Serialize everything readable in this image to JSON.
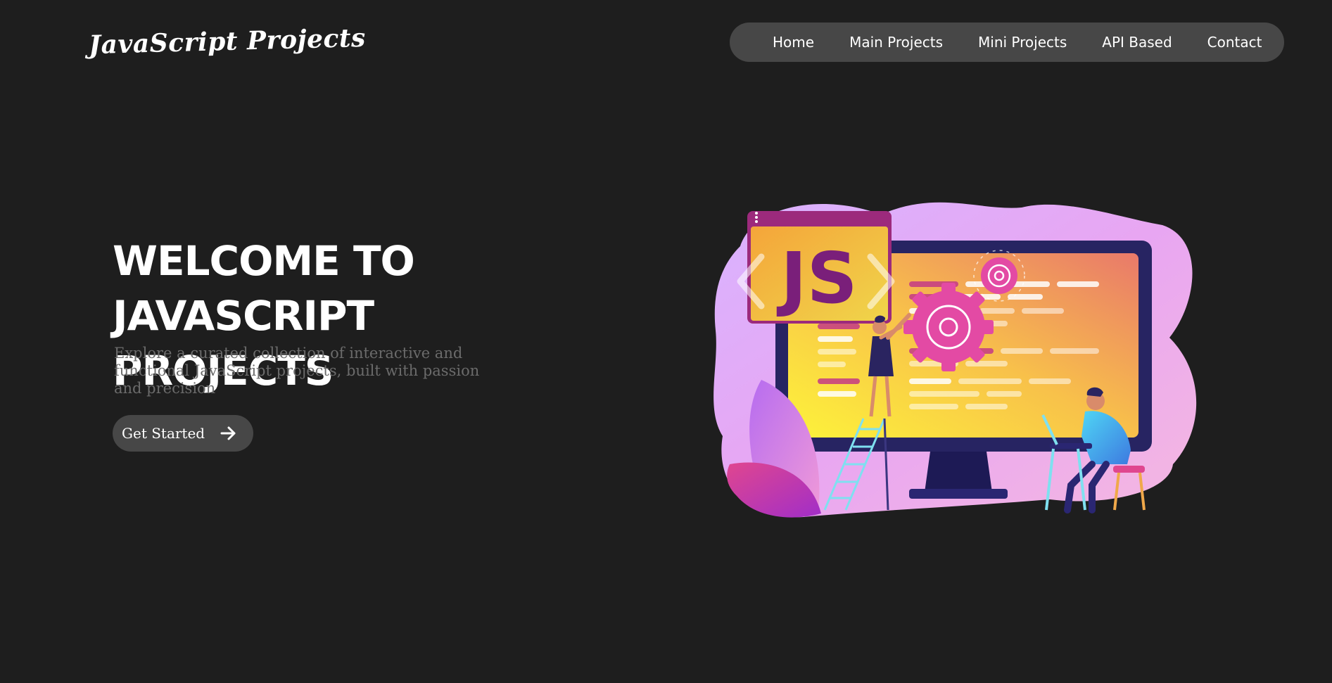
{
  "header": {
    "logo": "JavaScript Projects",
    "nav": [
      "Home",
      "Main Projects",
      "Mini Projects",
      "API Based",
      "Contact"
    ]
  },
  "hero": {
    "title_line1": "Welcome to",
    "title_line2": "JavaScript Projects",
    "description": "Explore a curated collection of interactive and functional JavaScript projects, built with passion and precision",
    "cta_label": "Get Started",
    "cta_icon": "arrow-right-icon",
    "illustration_text": "JS"
  },
  "colors": {
    "background": "#1e1e1e",
    "nav_bg": "#474747",
    "button_bg": "#474747",
    "text": "#ffffff",
    "muted_text": "#6b6b6b"
  }
}
